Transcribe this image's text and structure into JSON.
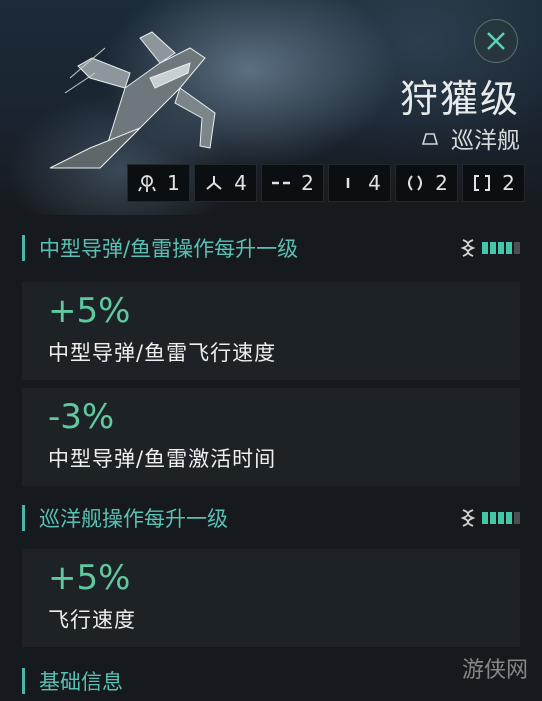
{
  "ship": {
    "name": "狩獾级",
    "class": "巡洋舰"
  },
  "slots": [
    {
      "icon": "high-slot-icon",
      "count": "1"
    },
    {
      "icon": "turret-icon",
      "count": "4"
    },
    {
      "icon": "mid-slot-icon",
      "count": "2"
    },
    {
      "icon": "low-slot-icon",
      "count": "4"
    },
    {
      "icon": "rig-icon",
      "count": "2"
    },
    {
      "icon": "subsystem-icon",
      "count": "2"
    }
  ],
  "sections": [
    {
      "title": "中型导弹/鱼雷操作每升一级",
      "skill_level": 4,
      "skill_max": 5,
      "bonuses": [
        {
          "value": "+5%",
          "desc": "中型导弹/鱼雷飞行速度"
        },
        {
          "value": "-3%",
          "desc": "中型导弹/鱼雷激活时间"
        }
      ]
    },
    {
      "title": "巡洋舰操作每升一级",
      "skill_level": 4,
      "skill_max": 5,
      "bonuses": [
        {
          "value": "+5%",
          "desc": "飞行速度"
        }
      ]
    },
    {
      "title": "基础信息"
    }
  ],
  "watermark": "游侠网",
  "colors": {
    "accent": "#59c0b3",
    "bonus_value": "#5fc9a0",
    "pip_on": "#43c7a6",
    "pip_off": "#4a5052"
  }
}
